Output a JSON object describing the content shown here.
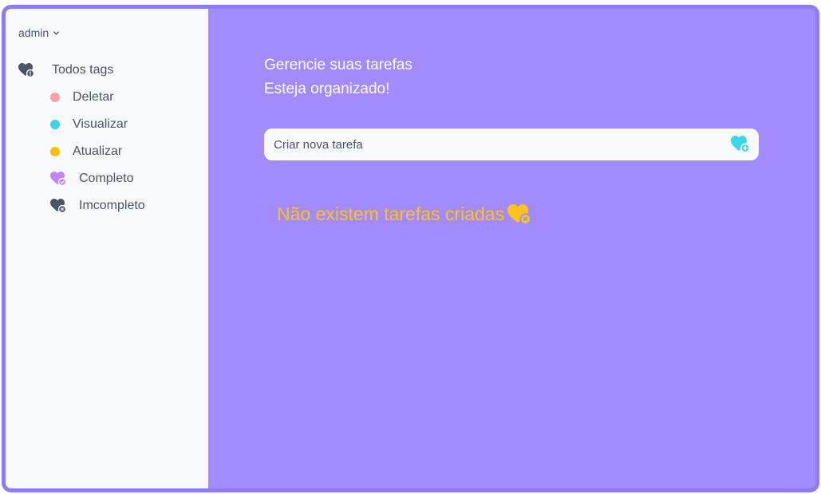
{
  "user_menu": {
    "label": "admin",
    "icon": "chevron-down-icon"
  },
  "sidebar": {
    "all_tags": {
      "label": "Todos tags",
      "icon": "heart-info-icon"
    },
    "items": [
      {
        "label": "Deletar",
        "icon": "dot",
        "color": "#f7a1a9"
      },
      {
        "label": "Visualizar",
        "icon": "dot",
        "color": "#3dd5e8"
      },
      {
        "label": "Atualizar",
        "icon": "dot",
        "color": "#f5c400"
      },
      {
        "label": "Completo",
        "icon": "heart-check-icon",
        "color": "#c084fc"
      },
      {
        "label": "Imcompleto",
        "icon": "heart-x-icon",
        "color": "#4b5563"
      }
    ]
  },
  "main": {
    "headline_line1": "Gerencie suas tarefas",
    "headline_line2": "Esteja organizado!",
    "task_input": {
      "placeholder": "Criar nova tarefa",
      "value": ""
    },
    "add_button_icon": "heart-plus-icon",
    "empty_message": "Não existem tarefas criadas",
    "empty_icon": "heart-x-icon"
  },
  "colors": {
    "accent": "#a28bfe",
    "frame_border": "#8e7cf7",
    "sidebar_bg": "#f8fafc",
    "empty_text": "#fcc419",
    "add_icon": "#3dd5e8"
  }
}
